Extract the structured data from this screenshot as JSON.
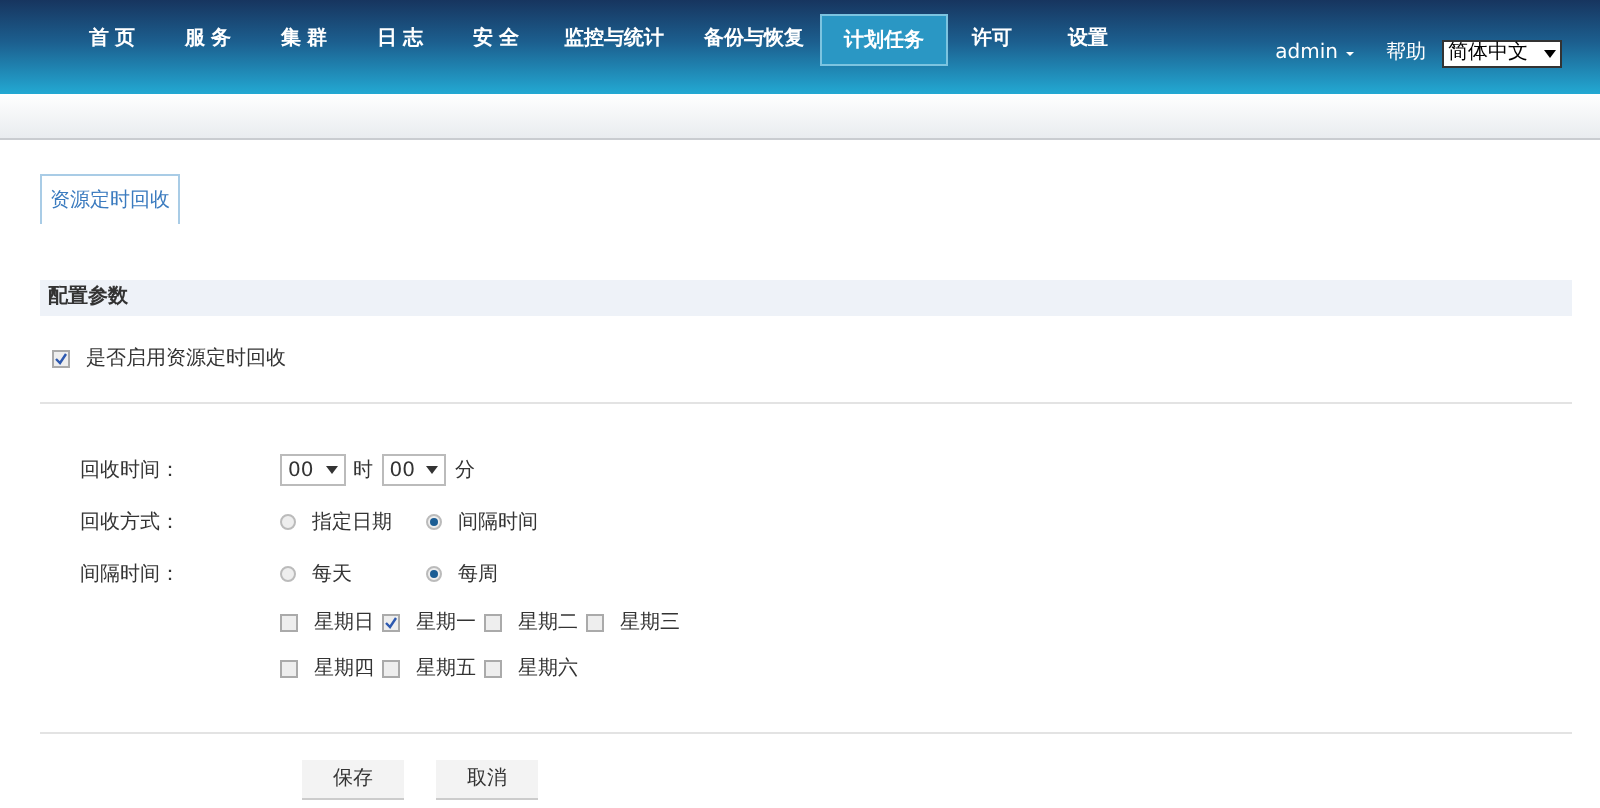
{
  "nav": {
    "items": [
      {
        "label": "首 页",
        "selected": false
      },
      {
        "label": "服 务",
        "selected": false
      },
      {
        "label": "集 群",
        "selected": false
      },
      {
        "label": "日 志",
        "selected": false
      },
      {
        "label": "安 全",
        "selected": false
      },
      {
        "label": "监控与统计",
        "selected": false
      },
      {
        "label": "备份与恢复",
        "selected": false
      },
      {
        "label": "计划任务",
        "selected": true
      },
      {
        "label": "许可",
        "selected": false
      },
      {
        "label": "设置",
        "selected": false
      }
    ],
    "user": "admin",
    "help": "帮助",
    "language": "简体中文"
  },
  "tabs": [
    {
      "label": "资源定时回收",
      "selected": true
    }
  ],
  "section": {
    "title": "配置参数"
  },
  "enable": {
    "label": "是否启用资源定时回收",
    "checked": true
  },
  "form": {
    "rows": [
      {
        "kind": "time",
        "label": "回收时间：",
        "hour": "00",
        "hour_unit": "时",
        "minute": "00",
        "minute_unit": "分"
      },
      {
        "kind": "radio",
        "label": "回收方式：",
        "options": [
          {
            "label": "指定日期",
            "selected": false
          },
          {
            "label": "间隔时间",
            "selected": true
          }
        ]
      },
      {
        "kind": "radio",
        "label": "间隔时间：",
        "options": [
          {
            "label": "每天",
            "selected": false
          },
          {
            "label": "每周",
            "selected": true
          }
        ]
      },
      {
        "kind": "checks",
        "options": [
          {
            "label": "星期日",
            "checked": false
          },
          {
            "label": "星期一",
            "checked": true
          },
          {
            "label": "星期二",
            "checked": false
          },
          {
            "label": "星期三",
            "checked": false
          },
          {
            "label": "星期四",
            "checked": false
          },
          {
            "label": "星期五",
            "checked": false
          },
          {
            "label": "星期六",
            "checked": false
          }
        ]
      }
    ]
  },
  "buttons": [
    {
      "label": "保存"
    },
    {
      "label": "取消"
    }
  ]
}
